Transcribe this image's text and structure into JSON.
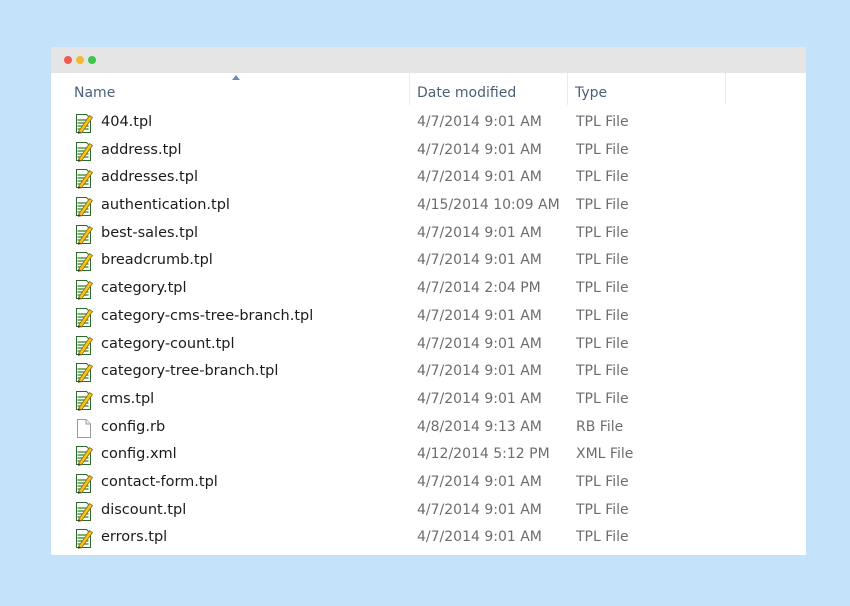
{
  "window": {
    "controls": [
      "close",
      "minimize",
      "zoom"
    ]
  },
  "columns": {
    "name": "Name",
    "date": "Date modified",
    "type": "Type",
    "sort_indicator": "^"
  },
  "files": [
    {
      "name": "404.tpl",
      "date": "4/7/2014 9:01 AM",
      "type": "TPL File",
      "icon": "tpl-file-icon"
    },
    {
      "name": "address.tpl",
      "date": "4/7/2014 9:01 AM",
      "type": "TPL File",
      "icon": "tpl-file-icon"
    },
    {
      "name": "addresses.tpl",
      "date": "4/7/2014 9:01 AM",
      "type": "TPL File",
      "icon": "tpl-file-icon"
    },
    {
      "name": "authentication.tpl",
      "date": "4/15/2014 10:09 AM",
      "type": "TPL File",
      "icon": "tpl-file-icon"
    },
    {
      "name": "best-sales.tpl",
      "date": "4/7/2014 9:01 AM",
      "type": "TPL File",
      "icon": "tpl-file-icon"
    },
    {
      "name": "breadcrumb.tpl",
      "date": "4/7/2014 9:01 AM",
      "type": "TPL File",
      "icon": "tpl-file-icon"
    },
    {
      "name": "category.tpl",
      "date": "4/7/2014 2:04 PM",
      "type": "TPL File",
      "icon": "tpl-file-icon"
    },
    {
      "name": "category-cms-tree-branch.tpl",
      "date": "4/7/2014 9:01 AM",
      "type": "TPL File",
      "icon": "tpl-file-icon"
    },
    {
      "name": "category-count.tpl",
      "date": "4/7/2014 9:01 AM",
      "type": "TPL File",
      "icon": "tpl-file-icon"
    },
    {
      "name": "category-tree-branch.tpl",
      "date": "4/7/2014 9:01 AM",
      "type": "TPL File",
      "icon": "tpl-file-icon"
    },
    {
      "name": "cms.tpl",
      "date": "4/7/2014 9:01 AM",
      "type": "TPL File",
      "icon": "tpl-file-icon"
    },
    {
      "name": "config.rb",
      "date": "4/8/2014 9:13 AM",
      "type": "RB File",
      "icon": "blank-file-icon"
    },
    {
      "name": "config.xml",
      "date": "4/12/2014 5:12 PM",
      "type": "XML File",
      "icon": "tpl-file-icon"
    },
    {
      "name": "contact-form.tpl",
      "date": "4/7/2014 9:01 AM",
      "type": "TPL File",
      "icon": "tpl-file-icon"
    },
    {
      "name": "discount.tpl",
      "date": "4/7/2014 9:01 AM",
      "type": "TPL File",
      "icon": "tpl-file-icon"
    },
    {
      "name": "errors.tpl",
      "date": "4/7/2014 9:01 AM",
      "type": "TPL File",
      "icon": "tpl-file-icon"
    }
  ],
  "colors": {
    "background": "#c4e3fb",
    "titlebar": "#e5e5e5",
    "header_text": "#4c607a",
    "name_text": "#1b1b1b",
    "meta_text": "#6d6d6d"
  }
}
